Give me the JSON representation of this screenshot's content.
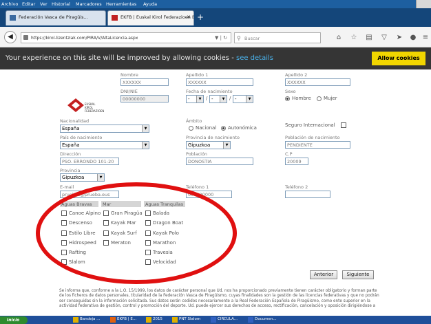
{
  "menubar": {
    "items": [
      "Archivo",
      "Editar",
      "Ver",
      "Historial",
      "Marcadores",
      "Herramientas",
      "Ayuda"
    ]
  },
  "tabs": [
    {
      "label": "Federación Vasca de Piragüis..."
    },
    {
      "label": "EKFB | Euskal Kirol Federazioen Ba..."
    }
  ],
  "nav": {
    "url": "https://kirol-lizentziak.com/PIRA/V/AltaLicencia.aspx",
    "search_placeholder": "Buscar"
  },
  "cookie": {
    "text": "Your experience on this site will be improved by allowing cookies - ",
    "link": "see details",
    "button": "Allow cookies"
  },
  "logo": {
    "line1": "EUSKAL",
    "line2": "KIROL",
    "line3": "FEDERAZIOEN"
  },
  "form": {
    "nombre": {
      "label": "Nombre",
      "value": "XXXXXX"
    },
    "apellido1": {
      "label": "Apellido 1",
      "value": "XXXXXX"
    },
    "apellido2": {
      "label": "Apellido 2",
      "value": "XXXXXX"
    },
    "dni": {
      "label": "DNI/NIE",
      "value": "00000000"
    },
    "fecha": {
      "label": "Fecha de nacimiento",
      "day": "-",
      "month": "-",
      "year": "-"
    },
    "sexo": {
      "label": "Sexo",
      "options": [
        "Hombre",
        "Mujer"
      ],
      "selected": "Hombre"
    },
    "nacionalidad": {
      "label": "Nacionalidad",
      "value": "España"
    },
    "ambito": {
      "label": "Ámbito",
      "options": [
        "Nacional",
        "Autonómica"
      ],
      "selected": "Autonómica"
    },
    "seguro": {
      "label": "Seguro Internacional"
    },
    "pais": {
      "label": "País de nacimiento",
      "value": "España"
    },
    "provincia_nac": {
      "label": "Provincia de nacimiento",
      "value": "Gipuzkoa"
    },
    "poblacion_nac": {
      "label": "Población de nacimiento",
      "value": "PENDIENTE"
    },
    "direccion": {
      "label": "Dirección",
      "value": "PSO. ERRONDO 101-20"
    },
    "poblacion": {
      "label": "Población",
      "value": "DONOSTIA"
    },
    "cp": {
      "label": "C.P",
      "value": "20009"
    },
    "provincia": {
      "label": "Provincia",
      "value": "Gipuzkoa"
    },
    "email": {
      "label": "E-mail",
      "value": "pruebas@prueba.eus"
    },
    "telefono1": {
      "label": "Teléfono 1",
      "value": "000000000"
    },
    "telefono2": {
      "label": "Teléfono 2",
      "value": ""
    }
  },
  "groups": {
    "bravas": {
      "title": "Aguas Bravas",
      "items": [
        "Canoe Alpino",
        "Descenso",
        "Estilo Libre",
        "Hidrospeed",
        "Rafting",
        "Slalom"
      ]
    },
    "mar": {
      "title": "Mar",
      "items": [
        "Gran Piragüa",
        "Kayak Mar",
        "Kayak Surf",
        "Meraton"
      ]
    },
    "tranquilas": {
      "title": "Aguas Tranquilas",
      "items": [
        "Balada",
        "Dragon Boat",
        "Kayak Polo",
        "Marathon",
        "Travesia",
        "Velocidad"
      ]
    }
  },
  "buttons": {
    "anterior": "Anterior",
    "siguiente": "Siguiente"
  },
  "privacy": "Se informa que, conforme a la L.O. 15/1999, los datos de carácter personal que Ud. nos ha proporcionado previamente tienen carácter obligatorio y forman parte de los ficheros de datos personales, titularidad de la Federación Vasca de Piragüismo, cuyas finalidades son la gestión de las licencias federativas y que no podrán ser conseguidas sin la información solicitada. Sus datos serán cedidos necesariamente a la Real Federación Española de Piragüismo, como ente superior en la actividad federativa de gestión, control y promoción del deporte. Ud. puede ejercer sus derechos de acceso, rectificación, cancelación y oposición dirigiéndose a",
  "taskbar": {
    "start": "Inicio",
    "items": [
      "Bandeja ...",
      "EKFB | E...",
      "2015",
      "PNT Slalom",
      "CIRCULA...",
      "Documen..."
    ]
  },
  "colors": {
    "cookie_bg": "#353535",
    "cookie_btn": "#f1d600",
    "circle": "#e01010",
    "taskbar": "#1f4f9a"
  }
}
